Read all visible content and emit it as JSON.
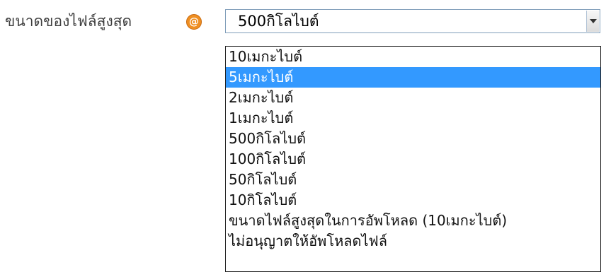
{
  "field": {
    "label": "ขนาดของไฟล์สูงสุด",
    "help_icon": "help-icon",
    "help_glyph": "@",
    "selected_value": "500กิโลไบต์"
  },
  "dropdown": {
    "highlighted_index": 1,
    "options": [
      "10เมกะไบต์",
      "5เมกะไบต์",
      "2เมกะไบต์",
      "1เมกะไบต์",
      "500กิโลไบต์",
      "100กิโลไบต์",
      "50กิโลไบต์",
      "10กิโลไบต์",
      "ขนาดไฟล์สูงสุดในการอัพโหลด (10เมกะไบต์)",
      "ไม่อนุญาตให้อัพโหลดไฟล์"
    ]
  },
  "colors": {
    "highlight": "#3399ff",
    "help_icon": "#ef8f22",
    "select_border": "#7f9db9"
  }
}
